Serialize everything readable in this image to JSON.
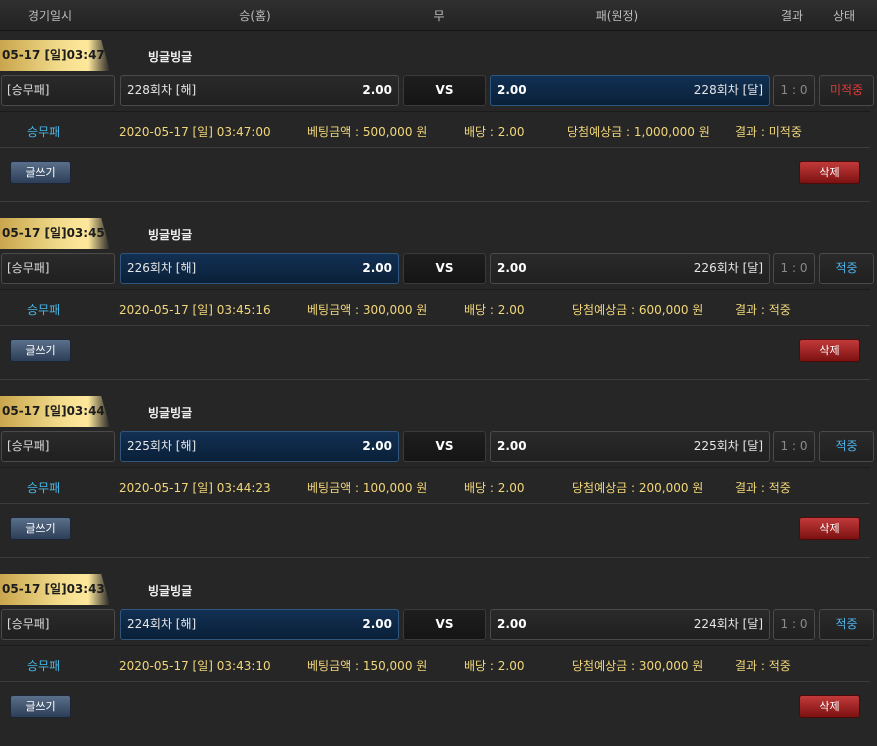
{
  "header": {
    "date": "경기일시",
    "home": "승(홈)",
    "draw": "무",
    "away": "패(원정)",
    "result": "결과",
    "status": "상태"
  },
  "bets": [
    {
      "date_tag": "05-17 [일]03:47",
      "team_name": "빙글빙글",
      "bet_type": "[승무패]",
      "home_team": "228회차 [해]",
      "home_odds": "2.00",
      "vs": "VS",
      "away_odds": "2.00",
      "away_team": "228회차 [달]",
      "score": "1 : 0",
      "status": "미적중",
      "game_type": "승무패",
      "datetime": "2020-05-17 [일] 03:47:00",
      "bet_amount": "베팅금액 : 500,000 원",
      "dividend": "배당 : 2.00",
      "expected_win": "당첨예상금 : 1,000,000 원",
      "result": "결과 : 미적중",
      "write_label": "글쓰기",
      "delete_label": "삭제"
    },
    {
      "date_tag": "05-17 [일]03:45",
      "team_name": "빙글빙글",
      "bet_type": "[승무패]",
      "home_team": "226회차 [해]",
      "home_odds": "2.00",
      "vs": "VS",
      "away_odds": "2.00",
      "away_team": "226회차 [달]",
      "score": "1 : 0",
      "status": "적중",
      "game_type": "승무패",
      "datetime": "2020-05-17 [일] 03:45:16",
      "bet_amount": "베팅금액 : 300,000 원",
      "dividend": "배당 : 2.00",
      "expected_win": "당첨예상금 : 600,000 원",
      "result": "결과 : 적중",
      "write_label": "글쓰기",
      "delete_label": "삭제"
    },
    {
      "date_tag": "05-17 [일]03:44",
      "team_name": "빙글빙글",
      "bet_type": "[승무패]",
      "home_team": "225회차 [해]",
      "home_odds": "2.00",
      "vs": "VS",
      "away_odds": "2.00",
      "away_team": "225회차 [달]",
      "score": "1 : 0",
      "status": "적중",
      "game_type": "승무패",
      "datetime": "2020-05-17 [일] 03:44:23",
      "bet_amount": "베팅금액 : 100,000 원",
      "dividend": "배당 : 2.00",
      "expected_win": "당첨예상금 : 200,000 원",
      "result": "결과 : 적중",
      "write_label": "글쓰기",
      "delete_label": "삭제"
    },
    {
      "date_tag": "05-17 [일]03:43",
      "team_name": "빙글빙글",
      "bet_type": "[승무패]",
      "home_team": "224회차 [해]",
      "home_odds": "2.00",
      "vs": "VS",
      "away_odds": "2.00",
      "away_team": "224회차 [달]",
      "score": "1 : 0",
      "status": "적중",
      "game_type": "승무패",
      "datetime": "2020-05-17 [일] 03:43:10",
      "bet_amount": "베팅금액 : 150,000 원",
      "dividend": "배당 : 2.00",
      "expected_win": "당첨예상금 : 300,000 원",
      "result": "결과 : 적중",
      "write_label": "글쓰기",
      "delete_label": "삭제"
    }
  ],
  "colors": {
    "lose_status": "#e13a3a",
    "win_status": "#4fb3ec",
    "info_text": "#f2d77a",
    "selected_box": "#123053"
  }
}
